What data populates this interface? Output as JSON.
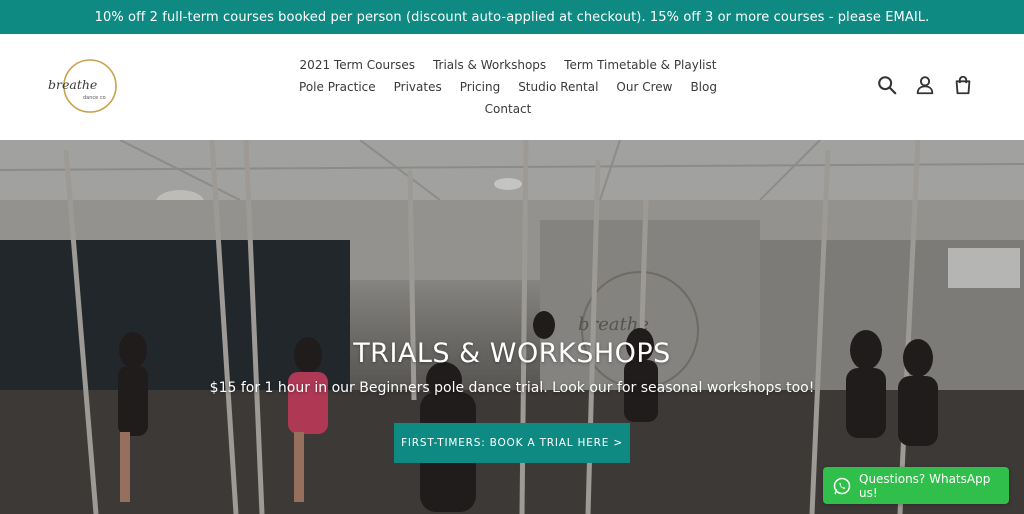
{
  "announcement": {
    "text": "10% off 2 full-term courses booked per person (discount auto-applied at checkout). 15% off 3 or more courses - please EMAIL."
  },
  "logo": {
    "word": "breathe",
    "sub": "dance co"
  },
  "nav": {
    "row1": [
      "2021 Term Courses",
      "Trials & Workshops",
      "Term Timetable & Playlist"
    ],
    "row2": [
      "Pole Practice",
      "Privates",
      "Pricing",
      "Studio Rental",
      "Our Crew",
      "Blog"
    ],
    "row3": [
      "Contact"
    ]
  },
  "header_icons": [
    "search-icon",
    "account-icon",
    "cart-icon"
  ],
  "hero": {
    "title": "TRIALS & WORKSHOPS",
    "subtitle": "$15 for 1 hour in our Beginners pole dance trial. Look our for seasonal workshops too!",
    "button_label": "FIRST-TIMERS: BOOK A TRIAL HERE >",
    "wall_sign": "breathe"
  },
  "whatsapp": {
    "label": "Questions? WhatsApp us!"
  },
  "colors": {
    "accent": "#0f8a83",
    "whatsapp": "#2fbf4a",
    "logo_ring": "#c9a24a"
  }
}
